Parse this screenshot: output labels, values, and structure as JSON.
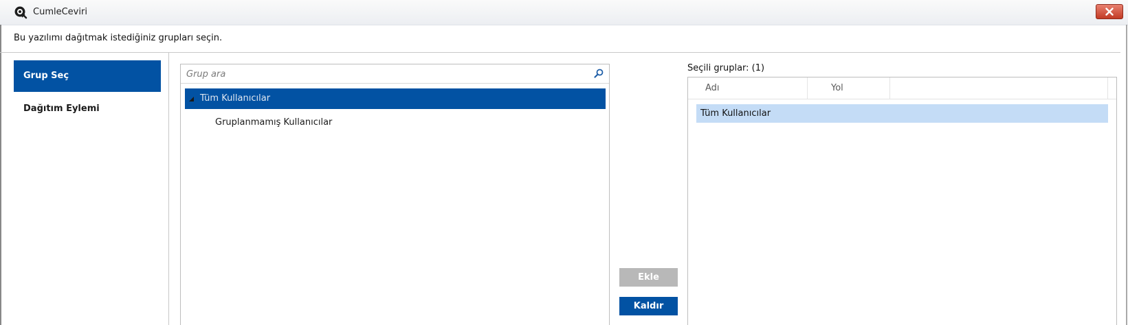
{
  "window": {
    "title": "CumleCeviri"
  },
  "instruction": "Bu yazılımı dağıtmak istediğiniz grupları seçin.",
  "nav": {
    "items": [
      {
        "label": "Grup Seç",
        "selected": true
      },
      {
        "label": "Dağıtım Eylemi",
        "selected": false
      }
    ]
  },
  "search": {
    "placeholder": "Grup ara",
    "value": ""
  },
  "tree": {
    "root": {
      "label": "Tüm Kullanıcılar",
      "expanded": true,
      "selected": true
    },
    "children": [
      {
        "label": "Gruplanmamış Kullanıcılar"
      }
    ]
  },
  "actions": {
    "add_label": "Ekle",
    "remove_label": "Kaldır"
  },
  "selected_groups": {
    "title": "Seçili gruplar: (1)",
    "columns": [
      "Adı",
      "Yol"
    ],
    "rows": [
      {
        "name": "Tüm Kullanıcılar",
        "path": ""
      }
    ]
  },
  "colors": {
    "accent": "#0252a3",
    "selected_row": "#c4dcf6",
    "disabled_button": "#b8b8b8",
    "close_button": "#c23a24"
  },
  "icons": {
    "app": "app-icon",
    "close": "close-icon",
    "search": "search-icon",
    "expand": "expand-triangle-icon"
  }
}
